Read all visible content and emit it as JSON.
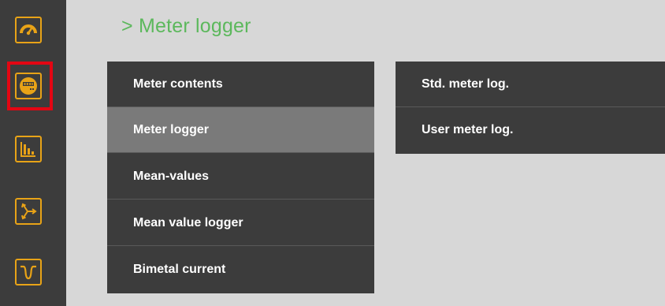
{
  "sidebar": {
    "icons": [
      "gauge-icon",
      "meter-icon",
      "bar-chart-icon",
      "vector-diagram-icon",
      "waveform-icon"
    ],
    "selected": "meter-icon"
  },
  "page": {
    "title": "> Meter logger"
  },
  "main_menu": {
    "items": [
      {
        "label": "Meter contents"
      },
      {
        "label": "Meter logger"
      },
      {
        "label": "Mean-values"
      },
      {
        "label": "Mean value logger"
      },
      {
        "label": "Bimetal current"
      }
    ],
    "active": "Meter logger"
  },
  "sub_menu": {
    "items": [
      {
        "label": "Std. meter log."
      },
      {
        "label": "User meter log."
      }
    ]
  },
  "colors": {
    "accent": "#e8a317",
    "title": "#5cb85c",
    "selection": "#e30613",
    "panel": "#3c3c3c",
    "active_item": "#7a7a7a"
  }
}
